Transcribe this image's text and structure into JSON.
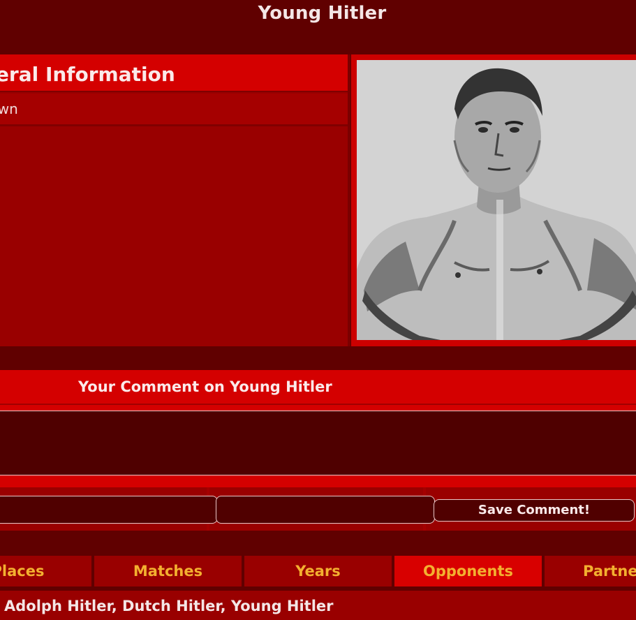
{
  "header": {
    "title": "Young Hitler"
  },
  "info": {
    "title": "General Information",
    "value": "Unknown"
  },
  "photo": {
    "subject": "wrestler-portrait"
  },
  "comment": {
    "title": "Your Comment on Young Hitler",
    "save_label": "Save Comment!"
  },
  "tabs": [
    {
      "label": "Places"
    },
    {
      "label": "Matches"
    },
    {
      "label": "Years"
    },
    {
      "label": "Opponents",
      "active": true
    },
    {
      "label": "Partners"
    }
  ],
  "aka": {
    "text": "Adolph Hitler, Dutch Hitler, Young Hitler"
  },
  "colors": {
    "background": "#600000",
    "header_red": "#d40000",
    "panel_red": "#990000",
    "tab_text": "#f3b030"
  }
}
